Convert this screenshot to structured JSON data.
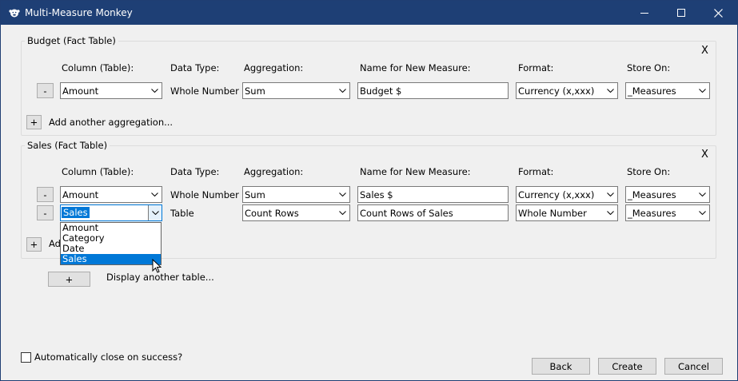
{
  "window": {
    "title": "Multi-Measure Monkey",
    "close_glyph": "✕"
  },
  "columns": {
    "column": "Column (Table):",
    "data_type": "Data Type:",
    "aggregation": "Aggregation:",
    "name": "Name for New Measure:",
    "format": "Format:",
    "store_on": "Store On:"
  },
  "common": {
    "remove": "-",
    "add": "+",
    "x": "X"
  },
  "budget": {
    "title": "Budget (Fact Table)",
    "row1": {
      "column": "Amount",
      "data_type": "Whole Number",
      "aggregation": "Sum",
      "name": "Budget $",
      "format": "Currency (x,xxx)",
      "store_on": "_Measures"
    },
    "add_label": "Add another aggregation..."
  },
  "sales": {
    "title": "Sales (Fact Table)",
    "row1": {
      "column": "Amount",
      "data_type": "Whole Number",
      "aggregation": "Sum",
      "name": "Sales $",
      "format": "Currency (x,xxx)",
      "store_on": "_Measures"
    },
    "row2": {
      "column": "Sales",
      "data_type": "Table",
      "aggregation": "Count Rows",
      "name": "Count Rows of Sales",
      "format": "Whole Number",
      "store_on": "_Measures"
    },
    "add_label_partial": "Ad",
    "dropdown_options": [
      "Amount",
      "Category",
      "Date",
      "Sales"
    ]
  },
  "display_table_label": "Display another table...",
  "auto_close_label": "Automatically close on success?",
  "footer": {
    "back": "Back",
    "create": "Create",
    "cancel": "Cancel"
  }
}
